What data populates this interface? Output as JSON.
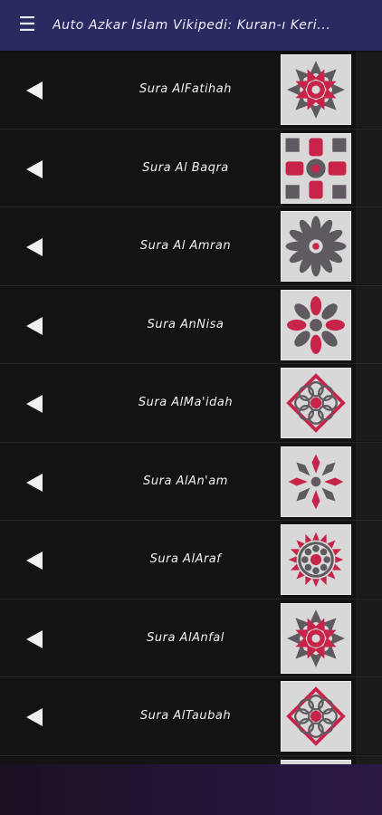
{
  "app_bar": {
    "menu_icon": "hamburger-menu-icon",
    "title": "Auto Azkar İslam Vikipedi: Kuran-ı Keri..."
  },
  "suras": [
    {
      "label": "Sura AlFatihah",
      "pattern": "star"
    },
    {
      "label": "Sura Al Baqra",
      "pattern": "cross"
    },
    {
      "label": "Sura Al Amran",
      "pattern": "flower"
    },
    {
      "label": "Sura AnNisa",
      "pattern": "petals"
    },
    {
      "label": "Sura AlMa'idah",
      "pattern": "diamond"
    },
    {
      "label": "Sura AlAn'am",
      "pattern": "snow"
    },
    {
      "label": "Sura AlAraf",
      "pattern": "rose"
    },
    {
      "label": "Sura AlAnfal",
      "pattern": "star"
    },
    {
      "label": "Sura AlTaubah",
      "pattern": "diamond"
    },
    {
      "label": "",
      "pattern": "petals"
    }
  ],
  "colors": {
    "app_bar": "#2a2a60",
    "background": "#131313",
    "tile_bg": "#d8d8d8",
    "accent_red": "#c8244a",
    "accent_gray": "#5f5a60"
  }
}
